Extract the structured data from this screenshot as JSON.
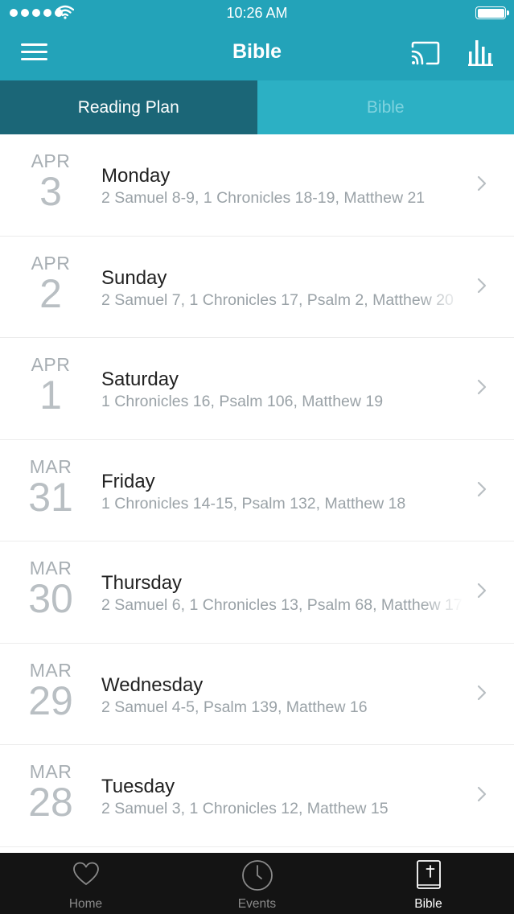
{
  "status_bar": {
    "time": "10:26 AM"
  },
  "nav": {
    "title": "Bible"
  },
  "segments": [
    {
      "label": "Reading Plan",
      "active": true
    },
    {
      "label": "Bible",
      "active": false
    }
  ],
  "plan": [
    {
      "month": "APR",
      "day": "3",
      "weekday": "Monday",
      "readings": "2 Samuel 8-9, 1 Chronicles 18-19, Matthew 21"
    },
    {
      "month": "APR",
      "day": "2",
      "weekday": "Sunday",
      "readings": "2 Samuel 7, 1 Chronicles 17, Psalm 2, Matthew 20"
    },
    {
      "month": "APR",
      "day": "1",
      "weekday": "Saturday",
      "readings": "1 Chronicles 16, Psalm 106, Matthew 19"
    },
    {
      "month": "MAR",
      "day": "31",
      "weekday": "Friday",
      "readings": "1 Chronicles 14-15, Psalm 132, Matthew 18"
    },
    {
      "month": "MAR",
      "day": "30",
      "weekday": "Thursday",
      "readings": "2 Samuel 6, 1 Chronicles 13, Psalm 68, Matthew 17"
    },
    {
      "month": "MAR",
      "day": "29",
      "weekday": "Wednesday",
      "readings": "2 Samuel 4-5, Psalm 139, Matthew 16"
    },
    {
      "month": "MAR",
      "day": "28",
      "weekday": "Tuesday",
      "readings": "2 Samuel 3, 1 Chronicles 12, Matthew 15"
    }
  ],
  "tabbar": [
    {
      "label": "Home",
      "icon": "heart-icon",
      "active": false
    },
    {
      "label": "Events",
      "icon": "clock-icon",
      "active": false
    },
    {
      "label": "Bible",
      "icon": "bible-icon",
      "active": true
    }
  ],
  "colors": {
    "header": "#23a3b9",
    "segment_active": "#1b6677",
    "segment_inactive": "#2cb0c4",
    "tabbar": "#141414"
  }
}
